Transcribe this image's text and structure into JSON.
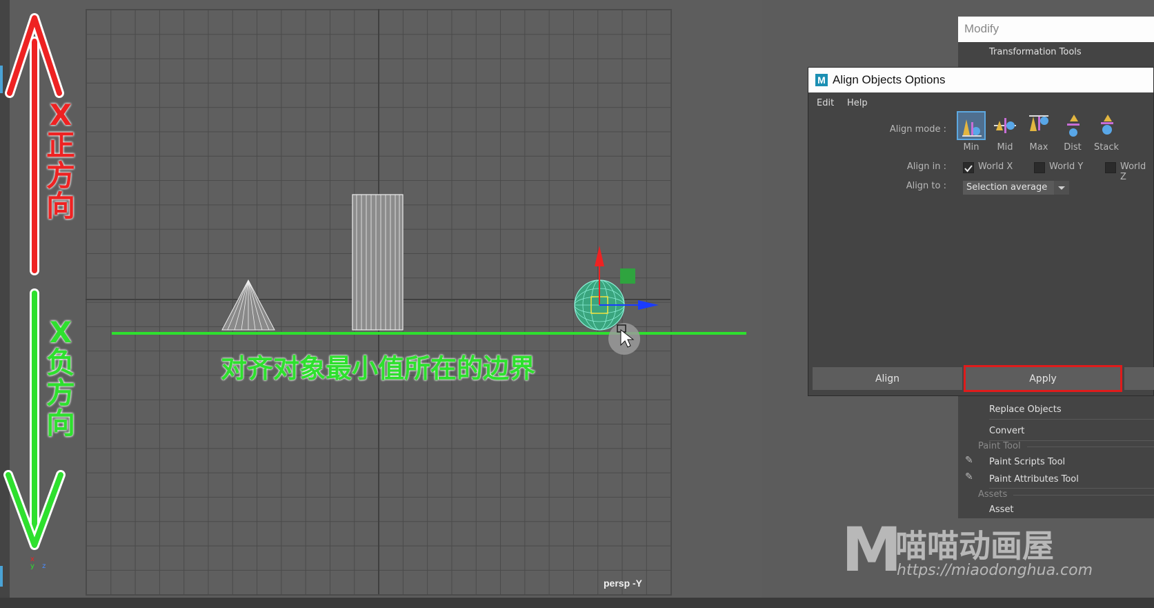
{
  "annotations": {
    "x_positive_chars": [
      "X",
      "正",
      "方",
      "向"
    ],
    "x_negative_chars": [
      "X",
      "负",
      "方",
      "向"
    ],
    "caption": "对齐对象最小值所在的边界"
  },
  "viewport": {
    "camera_label": "persp -Y",
    "axis_indicator": {
      "up": "x",
      "mid": "y",
      "right": "z"
    }
  },
  "dialog": {
    "title": "Align Objects Options",
    "logo_letter": "M",
    "menu": [
      "Edit",
      "Help"
    ],
    "align_mode_label": "Align mode :",
    "modes": [
      {
        "label": "Min",
        "icon": "align-min-icon",
        "active": true
      },
      {
        "label": "Mid",
        "icon": "align-mid-icon",
        "active": false
      },
      {
        "label": "Max",
        "icon": "align-max-icon",
        "active": false
      },
      {
        "label": "Dist",
        "icon": "align-dist-icon",
        "active": false
      },
      {
        "label": "Stack",
        "icon": "align-stack-icon",
        "active": false
      }
    ],
    "align_in_label": "Align in :",
    "align_in": [
      {
        "label": "World X",
        "checked": true
      },
      {
        "label": "World Y",
        "checked": false
      },
      {
        "label": "World Z",
        "checked": false
      }
    ],
    "align_to_label": "Align to :",
    "align_to_value": "Selection average",
    "buttons": {
      "align": "Align",
      "apply": "Apply"
    }
  },
  "modify_menu": {
    "title": "Modify",
    "items": {
      "transformation_tools": "Transformation Tools",
      "replace_objects": "Replace Objects",
      "convert": "Convert",
      "paint_tool_section": "Paint Tool",
      "paint_scripts_tool": "Paint Scripts Tool",
      "paint_attributes_tool": "Paint Attributes Tool",
      "assets_section": "Assets",
      "asset": "Asset"
    }
  },
  "watermark": {
    "letter": "M",
    "brand": "喵喵动画屋",
    "url": "https://miaodonghua.com"
  },
  "colors": {
    "accent_green": "#2ee02e",
    "arrow_red": "#ee2222",
    "highlight_red": "#e01b1b",
    "manipulator_blue": "#1a3cff"
  }
}
